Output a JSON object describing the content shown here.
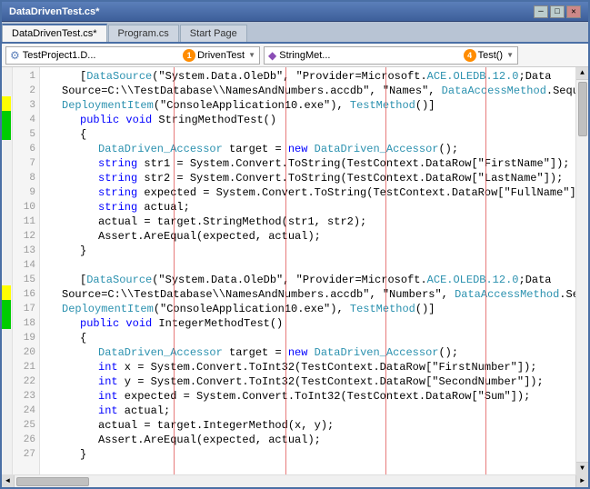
{
  "titlebar": {
    "text": "DataDrivenTest.cs*"
  },
  "tabs": [
    {
      "label": "DataDrivenTest.cs*",
      "active": true
    },
    {
      "label": "Program.cs",
      "active": false
    },
    {
      "label": "Start Page",
      "active": false
    }
  ],
  "dropdowns": [
    {
      "icon": "project-icon",
      "value": "TestProject1.D...",
      "suffix": "DrivenTest",
      "marker": "1"
    },
    {
      "icon": "string-icon",
      "value": "StringMet...",
      "suffix": "Test()",
      "marker": "4"
    }
  ],
  "code": {
    "lines": [
      {
        "indent": 2,
        "tokens": [
          {
            "cls": "plain",
            "text": "["
          },
          {
            "cls": "type",
            "text": "DataSource"
          },
          {
            "cls": "plain",
            "text": "(\"System.Data.OleDb\", \"Provider=Microsoft."
          },
          {
            "cls": "type",
            "text": "ACE.OLEDB.12.0"
          },
          {
            "cls": "plain",
            "text": ";Data"
          }
        ]
      },
      {
        "indent": 1,
        "tokens": [
          {
            "cls": "plain",
            "text": "Source=C:\\\\TestDatabase\\\\NamesAndNumbers.accdb\", \"Names\", "
          },
          {
            "cls": "type",
            "text": "DataAccessMethod"
          },
          {
            "cls": "plain",
            "text": ".Sequential),"
          }
        ]
      },
      {
        "indent": 1,
        "tokens": [
          {
            "cls": "type",
            "text": "DeploymentItem"
          },
          {
            "cls": "plain",
            "text": "(\"ConsoleApplication10.exe\"), "
          },
          {
            "cls": "type",
            "text": "TestMethod"
          },
          {
            "cls": "plain",
            "text": "()]"
          }
        ]
      },
      {
        "indent": 2,
        "tokens": [
          {
            "cls": "kw",
            "text": "public"
          },
          {
            "cls": "plain",
            "text": " "
          },
          {
            "cls": "kw",
            "text": "void"
          },
          {
            "cls": "plain",
            "text": " StringMethodTest()"
          }
        ]
      },
      {
        "indent": 2,
        "tokens": [
          {
            "cls": "plain",
            "text": "{"
          }
        ]
      },
      {
        "indent": 3,
        "tokens": [
          {
            "cls": "type",
            "text": "DataDriven_Accessor"
          },
          {
            "cls": "plain",
            "text": " target = "
          },
          {
            "cls": "kw",
            "text": "new"
          },
          {
            "cls": "plain",
            "text": " "
          },
          {
            "cls": "type",
            "text": "DataDriven_Accessor"
          },
          {
            "cls": "plain",
            "text": "();"
          }
        ]
      },
      {
        "indent": 3,
        "tokens": [
          {
            "cls": "kw",
            "text": "string"
          },
          {
            "cls": "plain",
            "text": " str1 = System.Convert.ToString(TestContext.DataRow[\"FirstName\"]);"
          }
        ]
      },
      {
        "indent": 3,
        "tokens": [
          {
            "cls": "kw",
            "text": "string"
          },
          {
            "cls": "plain",
            "text": " str2 = System.Convert.ToString(TestContext.DataRow[\"LastName\"]);"
          }
        ]
      },
      {
        "indent": 3,
        "tokens": [
          {
            "cls": "kw",
            "text": "string"
          },
          {
            "cls": "plain",
            "text": " expected = System.Convert.ToString(TestContext.DataRow[\"FullName\"]);"
          }
        ]
      },
      {
        "indent": 3,
        "tokens": [
          {
            "cls": "kw",
            "text": "string"
          },
          {
            "cls": "plain",
            "text": " actual;"
          }
        ]
      },
      {
        "indent": 3,
        "tokens": [
          {
            "cls": "plain",
            "text": "actual = target.StringMethod(str1, str2);"
          }
        ]
      },
      {
        "indent": 3,
        "tokens": [
          {
            "cls": "plain",
            "text": "Assert.AreEqual(expected, actual);"
          }
        ]
      },
      {
        "indent": 2,
        "tokens": [
          {
            "cls": "plain",
            "text": "}"
          }
        ]
      },
      {
        "indent": 0,
        "tokens": [
          {
            "cls": "plain",
            "text": ""
          }
        ]
      },
      {
        "indent": 2,
        "tokens": [
          {
            "cls": "plain",
            "text": "["
          },
          {
            "cls": "type",
            "text": "DataSource"
          },
          {
            "cls": "plain",
            "text": "(\"System.Data.OleDb\", \"Provider=Microsoft."
          },
          {
            "cls": "type",
            "text": "ACE.OLEDB.12.0"
          },
          {
            "cls": "plain",
            "text": ";Data"
          }
        ]
      },
      {
        "indent": 1,
        "tokens": [
          {
            "cls": "plain",
            "text": "Source=C:\\\\TestDatabase\\\\NamesAndNumbers.accdb\", \"Numbers\", "
          },
          {
            "cls": "type",
            "text": "DataAccessMethod"
          },
          {
            "cls": "plain",
            "text": ".Sequential),"
          }
        ]
      },
      {
        "indent": 1,
        "tokens": [
          {
            "cls": "type",
            "text": "DeploymentItem"
          },
          {
            "cls": "plain",
            "text": "(\"ConsoleApplication10.exe\"), "
          },
          {
            "cls": "type",
            "text": "TestMethod"
          },
          {
            "cls": "plain",
            "text": "()]"
          }
        ]
      },
      {
        "indent": 2,
        "tokens": [
          {
            "cls": "kw",
            "text": "public"
          },
          {
            "cls": "plain",
            "text": " "
          },
          {
            "cls": "kw",
            "text": "void"
          },
          {
            "cls": "plain",
            "text": " IntegerMethodTest()"
          }
        ]
      },
      {
        "indent": 2,
        "tokens": [
          {
            "cls": "plain",
            "text": "{"
          }
        ]
      },
      {
        "indent": 3,
        "tokens": [
          {
            "cls": "type",
            "text": "DataDriven_Accessor"
          },
          {
            "cls": "plain",
            "text": " target = "
          },
          {
            "cls": "kw",
            "text": "new"
          },
          {
            "cls": "plain",
            "text": " "
          },
          {
            "cls": "type",
            "text": "DataDriven_Accessor"
          },
          {
            "cls": "plain",
            "text": "();"
          }
        ]
      },
      {
        "indent": 3,
        "tokens": [
          {
            "cls": "kw",
            "text": "int"
          },
          {
            "cls": "plain",
            "text": " x = System.ToInt32(TestContext.DataRow[\"FirstNumber\"]);"
          }
        ]
      },
      {
        "indent": 3,
        "tokens": [
          {
            "cls": "kw",
            "text": "int"
          },
          {
            "cls": "plain",
            "text": " y = System.ToInt32(TestContext.DataRow[\"SecondNumber\"]);"
          }
        ]
      },
      {
        "indent": 3,
        "tokens": [
          {
            "cls": "kw",
            "text": "int"
          },
          {
            "cls": "plain",
            "text": " expected = System.ToInt32(TestContext.DataRow[\"Sum\"]);"
          }
        ]
      },
      {
        "indent": 3,
        "tokens": [
          {
            "cls": "kw",
            "text": "int"
          },
          {
            "cls": "plain",
            "text": " actual;"
          }
        ]
      },
      {
        "indent": 3,
        "tokens": [
          {
            "cls": "plain",
            "text": "actual = target.IntegerMethod(x, y);"
          }
        ]
      },
      {
        "indent": 3,
        "tokens": [
          {
            "cls": "plain",
            "text": "Assert.AreEqual(expected, actual);"
          }
        ]
      },
      {
        "indent": 2,
        "tokens": [
          {
            "cls": "plain",
            "text": "}"
          }
        ]
      }
    ]
  },
  "colors": {
    "accent": "#4a6fa5",
    "active_tab_bg": "#f5f5f5",
    "inactive_tab_bg": "#cdd5e0"
  }
}
